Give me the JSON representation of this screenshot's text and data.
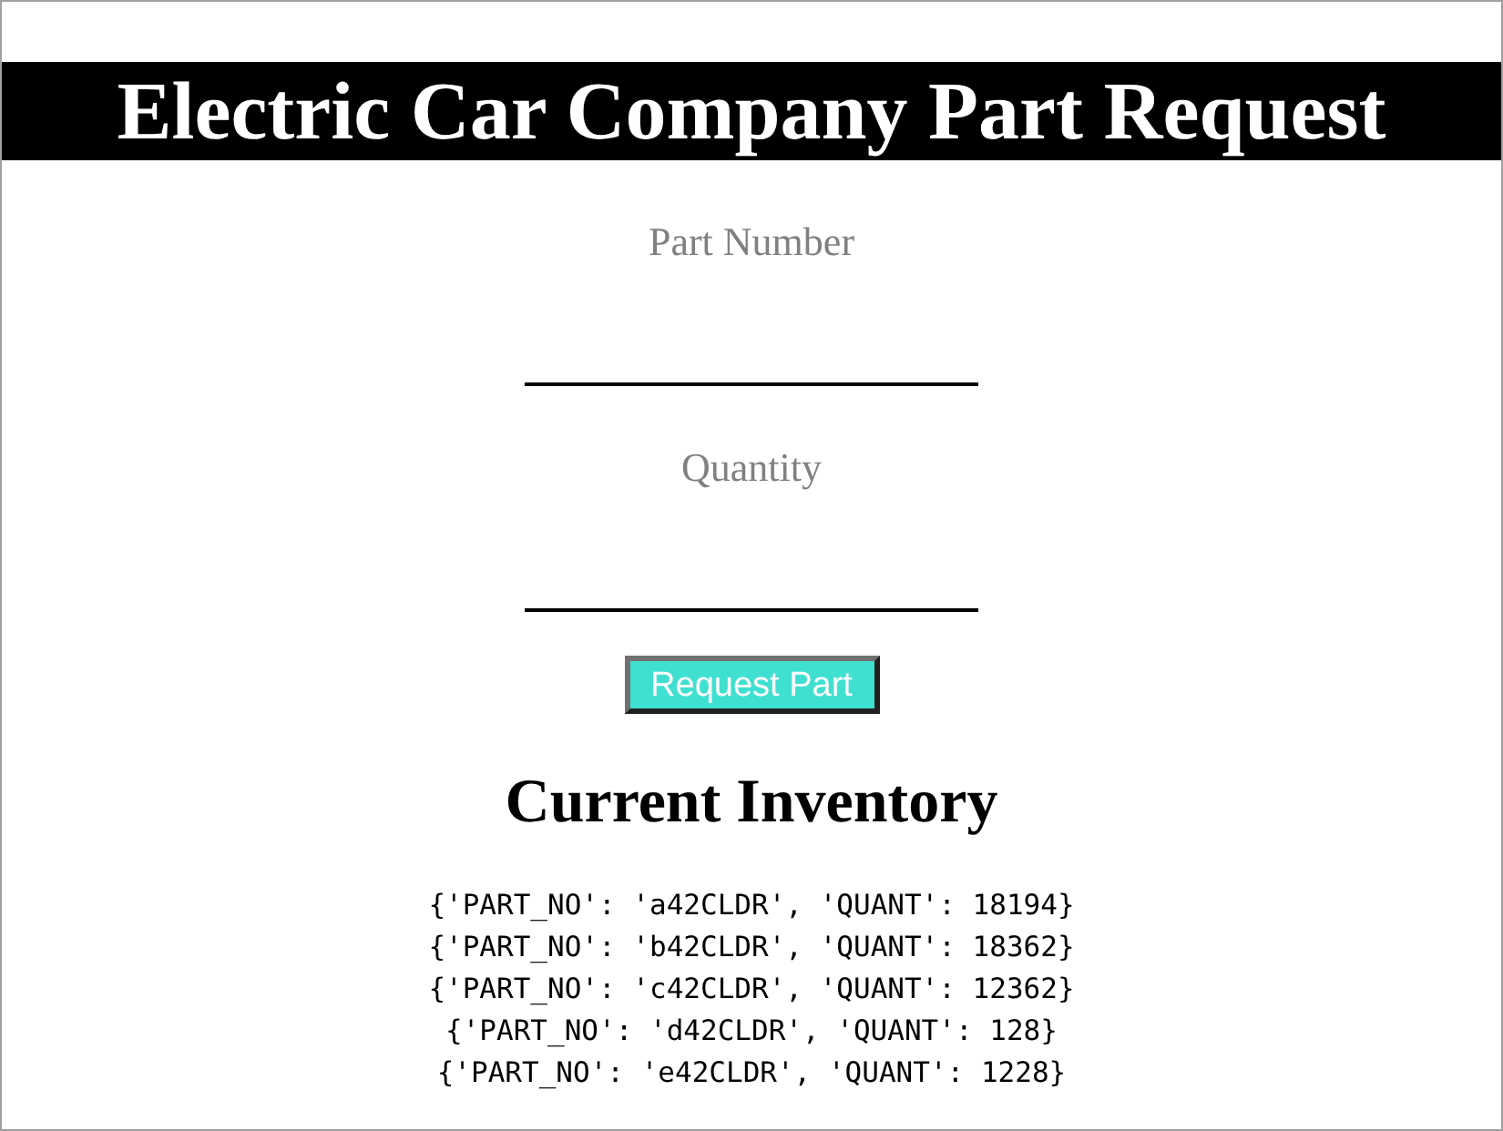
{
  "banner": {
    "title": "Electric Car Company Part Request"
  },
  "form": {
    "fields": [
      {
        "label": "Part Number"
      },
      {
        "label": "Quantity"
      }
    ],
    "button": "Request Part"
  },
  "inventory": {
    "heading": "Current Inventory",
    "lines": [
      "{'PART_NO': 'a42CLDR', 'QUANT': 18194}",
      "{'PART_NO': 'b42CLDR', 'QUANT': 18362}",
      "{'PART_NO': 'c42CLDR', 'QUANT': 12362}",
      "{'PART_NO': 'd42CLDR', 'QUANT': 128}",
      "{'PART_NO': 'e42CLDR', 'QUANT': 1228}"
    ]
  }
}
